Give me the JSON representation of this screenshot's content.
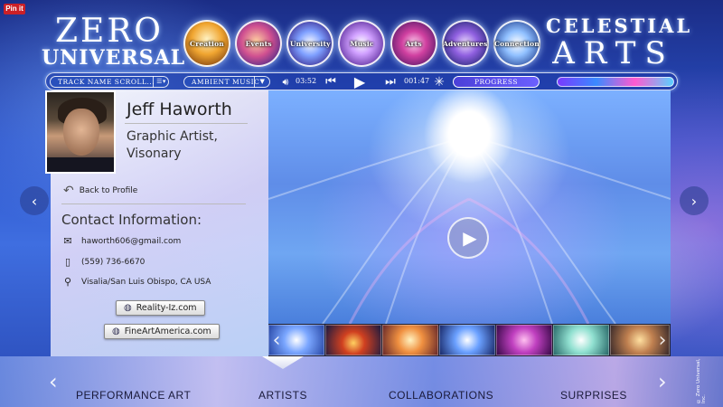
{
  "pinit": {
    "label": "Pin it"
  },
  "logo_left": {
    "line1": "ZERO",
    "line2": "UNIVERSAL"
  },
  "logo_right": {
    "line1": "CELESTIAL",
    "line2": "ARTS"
  },
  "nav_orbs": [
    {
      "label": "Creation"
    },
    {
      "label": "Events"
    },
    {
      "label": "University"
    },
    {
      "label": "Music"
    },
    {
      "label": "Arts"
    },
    {
      "label": "Adventures"
    },
    {
      "label": "Connection"
    }
  ],
  "player": {
    "track_placeholder": "TRACK NAME SCROLL...",
    "track_menu_icon": "list-dropdown-icon",
    "genre": "AMBIENT MUSIC",
    "genre_dropdown_icon": "chevron-down-icon",
    "volume_icon": "speaker-icon",
    "elapsed": "03:52",
    "prev_icon": "rewind-icon",
    "play_icon": "play-icon",
    "next_icon": "fast-forward-icon",
    "remaining": "001:47",
    "settings_icon": "star-icon",
    "progress_label": "PROGRESS",
    "visualizer_icon": "waveform-icon"
  },
  "profile": {
    "name": "Jeff Haworth",
    "title": "Graphic Artist, Visonary",
    "back_label": "Back to Profile",
    "contact_heading": "Contact Information:",
    "email": "haworth606@gmail.com",
    "phone": "(559) 736-6670",
    "location": "Visalia/San Luis Obispo, CA USA",
    "links": [
      {
        "label": "Reality-Iz.com"
      },
      {
        "label": "FineArtAmerica.com"
      }
    ]
  },
  "video": {
    "play_icon": "play-circle-icon"
  },
  "bottom_nav": [
    {
      "label": "PERFORMANCE ART"
    },
    {
      "label": "ARTISTS"
    },
    {
      "label": "COLLABORATIONS"
    },
    {
      "label": "SURPRISES"
    }
  ],
  "copyright": "© Zero Universal, Inc."
}
